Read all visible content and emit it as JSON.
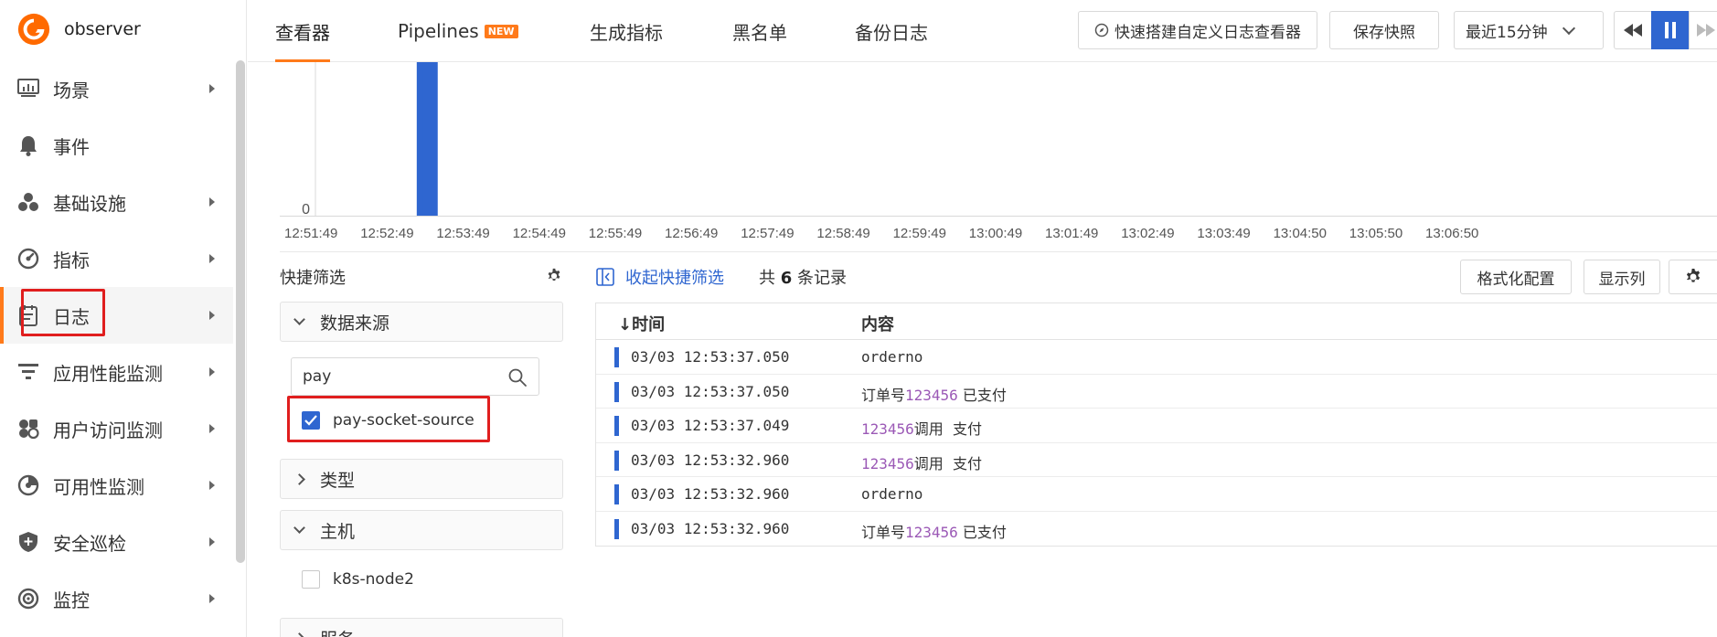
{
  "app": {
    "name": "observer"
  },
  "sidebar": {
    "items": [
      {
        "label": "场景",
        "icon": "dashboard-icon",
        "has_children": true
      },
      {
        "label": "事件",
        "icon": "bell-icon",
        "has_children": false
      },
      {
        "label": "基础设施",
        "icon": "cubes-icon",
        "has_children": true
      },
      {
        "label": "指标",
        "icon": "gauge-icon",
        "has_children": true
      },
      {
        "label": "日志",
        "icon": "log-document-icon",
        "has_children": true,
        "active": true
      },
      {
        "label": "应用性能监测",
        "icon": "apm-icon",
        "has_children": true
      },
      {
        "label": "用户访问监测",
        "icon": "rum-icon",
        "has_children": true
      },
      {
        "label": "可用性监测",
        "icon": "availability-icon",
        "has_children": true
      },
      {
        "label": "安全巡检",
        "icon": "shield-icon",
        "has_children": true
      },
      {
        "label": "监控",
        "icon": "monitor-icon",
        "has_children": true
      }
    ]
  },
  "topbar": {
    "tabs": [
      {
        "label": "查看器",
        "active": true
      },
      {
        "label": "Pipelines",
        "badge": "NEW"
      },
      {
        "label": "生成指标"
      },
      {
        "label": "黑名单"
      },
      {
        "label": "备份日志"
      }
    ],
    "quick_build_label": "快速搭建自定义日志查看器",
    "save_snapshot_label": "保存快照",
    "time_range": "最近15分钟"
  },
  "chart_data": {
    "type": "bar",
    "x_ticks": [
      "12:51:49",
      "12:52:49",
      "12:53:49",
      "12:54:49",
      "12:55:49",
      "12:56:49",
      "12:57:49",
      "12:58:49",
      "12:59:49",
      "13:00:49",
      "13:01:49",
      "13:02:49",
      "13:03:49",
      "13:04:50",
      "13:05:50",
      "13:06:50"
    ],
    "y_tick_zero": "0",
    "bars": [
      {
        "x": "12:53:32",
        "value": 3
      },
      {
        "x": "12:53:37",
        "value": 3
      }
    ],
    "bar_color": "#2f66d0"
  },
  "quick_filter": {
    "title": "快捷筛选",
    "groups": {
      "source": {
        "label": "数据来源",
        "expanded": true
      },
      "type": {
        "label": "类型",
        "expanded": false
      },
      "host": {
        "label": "主机",
        "expanded": true
      },
      "service": {
        "label": "服务",
        "expanded": false
      }
    },
    "search_value": "pay",
    "source_options": [
      {
        "label": "pay-socket-source",
        "checked": true
      }
    ],
    "host_options": [
      {
        "label": "k8s-node2",
        "checked": false
      }
    ]
  },
  "logs": {
    "collapse_label": "收起快捷筛选",
    "count_prefix": "共",
    "count": "6",
    "count_suffix": "条记录",
    "format_config_label": "格式化配置",
    "show_columns_label": "显示列",
    "columns": {
      "time": "↓时间",
      "content": "内容"
    },
    "rows": [
      {
        "time": "03/03 12:53:37.050",
        "parts": [
          {
            "t": "orderno",
            "k": "txt"
          }
        ]
      },
      {
        "time": "03/03 12:53:37.050",
        "parts": [
          {
            "t": "订单号",
            "k": "cn"
          },
          {
            "t": "123456",
            "k": "num"
          },
          {
            "t": " 已支付",
            "k": "cn"
          }
        ]
      },
      {
        "time": "03/03 12:53:37.049",
        "parts": [
          {
            "t": "123456",
            "k": "num"
          },
          {
            "t": "调用  支付",
            "k": "cn"
          }
        ]
      },
      {
        "time": "03/03 12:53:32.960",
        "parts": [
          {
            "t": "123456",
            "k": "num"
          },
          {
            "t": "调用  支付",
            "k": "cn"
          }
        ]
      },
      {
        "time": "03/03 12:53:32.960",
        "parts": [
          {
            "t": "orderno",
            "k": "txt"
          }
        ]
      },
      {
        "time": "03/03 12:53:32.960",
        "parts": [
          {
            "t": "订单号",
            "k": "cn"
          },
          {
            "t": "123456",
            "k": "num"
          },
          {
            "t": " 已支付",
            "k": "cn"
          }
        ]
      }
    ]
  }
}
